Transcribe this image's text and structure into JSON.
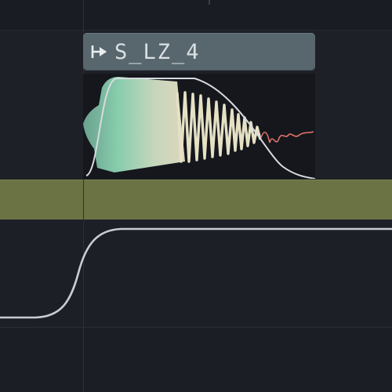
{
  "clip": {
    "name": "S_LZ_4",
    "icon": "play-marker-icon"
  },
  "colors": {
    "clip_header": "#58666d",
    "clip_name_text": "#d9e1e4",
    "waveform_light": "#8fd7b5",
    "waveform_dark": "#5a8f7a",
    "waveform_cream": "#e6e1c5",
    "waveform_tail": "#e07368",
    "track_olive": "#6b7345",
    "automation_line": "#c9ccd3",
    "background": "#1c1e26"
  }
}
